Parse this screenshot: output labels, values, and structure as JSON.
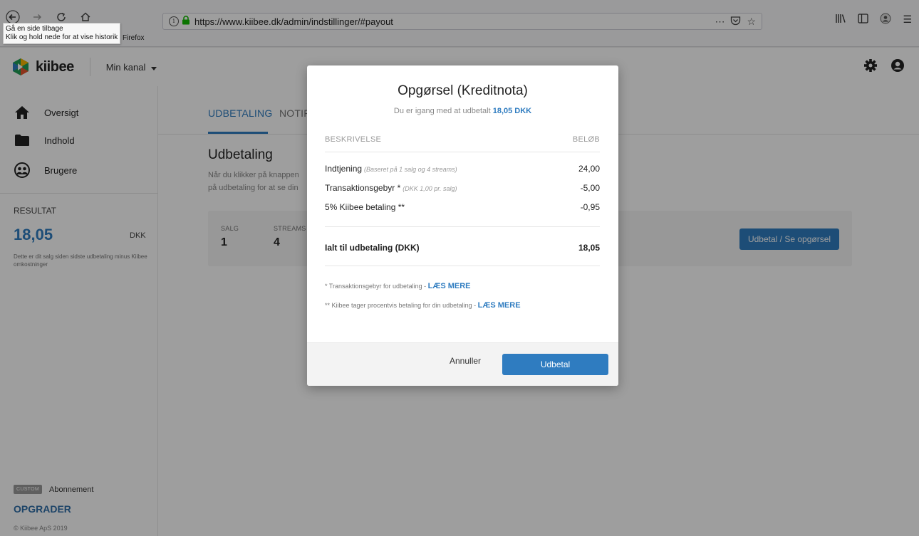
{
  "browser": {
    "url": "https://www.kiibee.dk/admin/indstillinger/#payout",
    "tooltip_line1": "Gå en side tilbage",
    "tooltip_line2": "Klik og hold nede for at vise historik",
    "bookmark_label": "Firefox"
  },
  "header": {
    "brand": "kiibee",
    "channel_label": "Min kanal"
  },
  "sidebar": {
    "items": [
      {
        "label": "Oversigt",
        "icon": "home-icon"
      },
      {
        "label": "Indhold",
        "icon": "folder-icon"
      },
      {
        "label": "Brugere",
        "icon": "users-icon"
      }
    ],
    "result_label": "RESULTAT",
    "result_value": "18,05",
    "result_currency": "DKK",
    "result_note": "Dette er dit salg siden sidste udbetaling minus Kiibee omkostninger",
    "plan_badge": "CUSTOM",
    "plan_label": "Abonnement",
    "upgrade_label": "OPGRADER",
    "copyright": "© Kiibee ApS 2019"
  },
  "main": {
    "tabs": [
      {
        "label": "UDBETALING"
      },
      {
        "label": "NOTIF"
      }
    ],
    "title": "Udbetaling",
    "description_line1": "Når du klikker på knappen",
    "description_line2": "på udbetaling for at se din",
    "stats": [
      {
        "label": "SALG",
        "value": "1"
      },
      {
        "label": "STREAMS",
        "value": "4"
      }
    ],
    "payout_button": "Udbetal / Se opgørsel"
  },
  "modal": {
    "title": "Opgørsel (Kreditnota)",
    "subtitle_prefix": "Du er igang med at udbetalt",
    "subtitle_amount": "18,05 DKK",
    "col_description": "BESKRIVELSE",
    "col_amount": "BELØB",
    "rows": [
      {
        "label": "Indtjening",
        "note": "(Baseret på 1 salg og 4 streams)",
        "amount": "24,00"
      },
      {
        "label": "Transaktionsgebyr *",
        "note": "(DKK 1,00 pr. salg)",
        "amount": "-5,00"
      },
      {
        "label": "5% Kiibee betaling **",
        "note": "",
        "amount": "-0,95"
      }
    ],
    "total_label": "Ialt til udbetaling (DKK)",
    "total_amount": "18,05",
    "footnote1": "* Transaktionsgebyr for udbetaling -",
    "footnote2": "** Kiibee tager procentvis betaling for din udbetaling -",
    "read_more": "LÆS MERE",
    "cancel": "Annuller",
    "confirm": "Udbetal"
  },
  "colors": {
    "accent": "#2f7cc0"
  }
}
